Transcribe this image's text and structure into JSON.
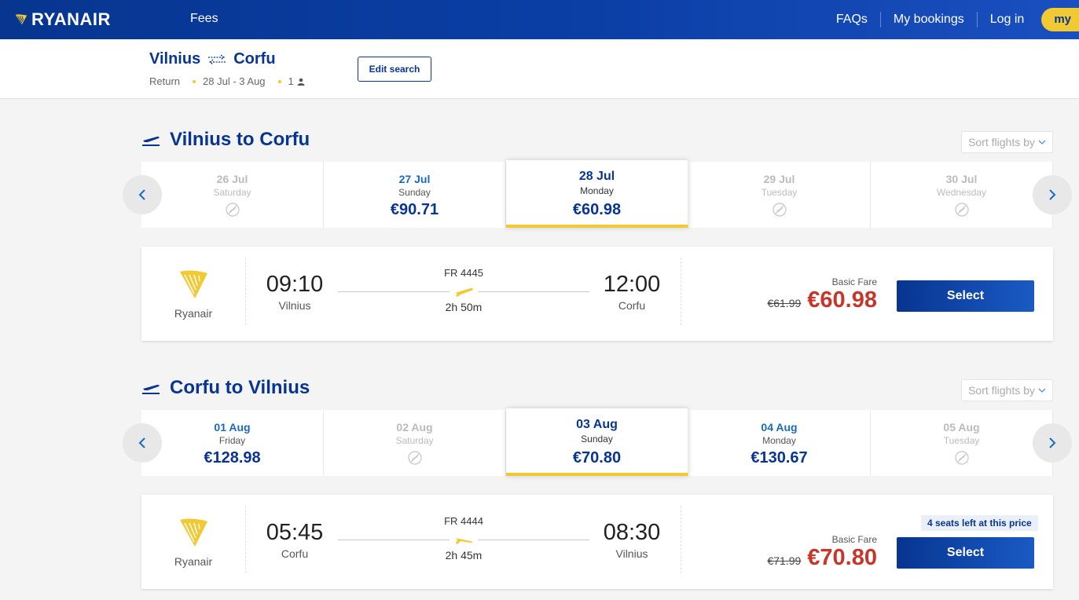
{
  "header": {
    "brand": "RYANAIR",
    "nav_fees": "Fees",
    "nav_faqs": "FAQs",
    "nav_bookings": "My bookings",
    "nav_login": "Log in",
    "my_pill": "my"
  },
  "search": {
    "origin": "Vilnius",
    "destination": "Corfu",
    "trip_type": "Return",
    "dates": "28 Jul - 3 Aug",
    "passengers": "1",
    "edit_label": "Edit search"
  },
  "outbound": {
    "title": "Vilnius to Corfu",
    "sort_label": "Sort flights by",
    "dates": [
      {
        "date": "26 Jul",
        "weekday": "Saturday",
        "price": "",
        "available": false
      },
      {
        "date": "27 Jul",
        "weekday": "Sunday",
        "price": "€90.71",
        "available": true
      },
      {
        "date": "28 Jul",
        "weekday": "Monday",
        "price": "€60.98",
        "available": true,
        "selected": true
      },
      {
        "date": "29 Jul",
        "weekday": "Tuesday",
        "price": "",
        "available": false
      },
      {
        "date": "30 Jul",
        "weekday": "Wednesday",
        "price": "",
        "available": false
      }
    ],
    "flight": {
      "carrier": "Ryanair",
      "dep_time": "09:10",
      "dep_city": "Vilnius",
      "flight_no": "FR 4445",
      "duration": "2h 50m",
      "arr_time": "12:00",
      "arr_city": "Corfu",
      "fare_label": "Basic Fare",
      "old_price": "€61.99",
      "price": "€60.98",
      "select_label": "Select"
    }
  },
  "inbound": {
    "title": "Corfu to Vilnius",
    "sort_label": "Sort flights by",
    "dates": [
      {
        "date": "01 Aug",
        "weekday": "Friday",
        "price": "€128.98",
        "available": true
      },
      {
        "date": "02 Aug",
        "weekday": "Saturday",
        "price": "",
        "available": false
      },
      {
        "date": "03 Aug",
        "weekday": "Sunday",
        "price": "€70.80",
        "available": true,
        "selected": true
      },
      {
        "date": "04 Aug",
        "weekday": "Monday",
        "price": "€130.67",
        "available": true
      },
      {
        "date": "05 Aug",
        "weekday": "Tuesday",
        "price": "",
        "available": false
      }
    ],
    "flight": {
      "carrier": "Ryanair",
      "dep_time": "05:45",
      "dep_city": "Corfu",
      "flight_no": "FR 4444",
      "duration": "2h 45m",
      "arr_time": "08:30",
      "arr_city": "Vilnius",
      "seats_note": "4 seats left at this price",
      "fare_label": "Basic Fare",
      "old_price": "€71.99",
      "price": "€70.80",
      "select_label": "Select"
    }
  },
  "colors": {
    "brand_blue": "#073590",
    "brand_yellow": "#f1c933",
    "price_red": "#c7362b"
  }
}
